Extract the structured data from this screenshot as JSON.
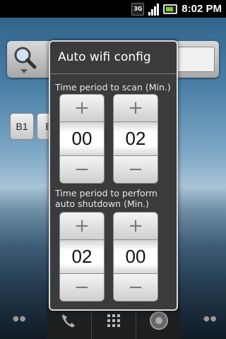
{
  "status_bar": {
    "network_badge": "3G",
    "time": "8:02 PM",
    "battery_color": "#7ccf2b"
  },
  "home_screen": {
    "search_icon": "magnifier-icon",
    "shortcuts": [
      {
        "label": "B1"
      },
      {
        "label": "B"
      }
    ],
    "dock": {
      "icons": [
        "phone-icon",
        "app-grid-icon",
        "browser-icon"
      ]
    }
  },
  "dialog": {
    "title": "Auto wifi config",
    "scan_section": {
      "label": "Time period to scan (Min.)",
      "pickers": [
        {
          "value": "00",
          "plus": "+",
          "minus": "−"
        },
        {
          "value": "02",
          "plus": "+",
          "minus": "−"
        }
      ]
    },
    "shutdown_section": {
      "label_line1": "Time period to perform",
      "label_line2": "auto shutdown (Min.)",
      "pickers": [
        {
          "value": "02",
          "plus": "+",
          "minus": "−"
        },
        {
          "value": "00",
          "plus": "+",
          "minus": "−"
        }
      ]
    }
  }
}
